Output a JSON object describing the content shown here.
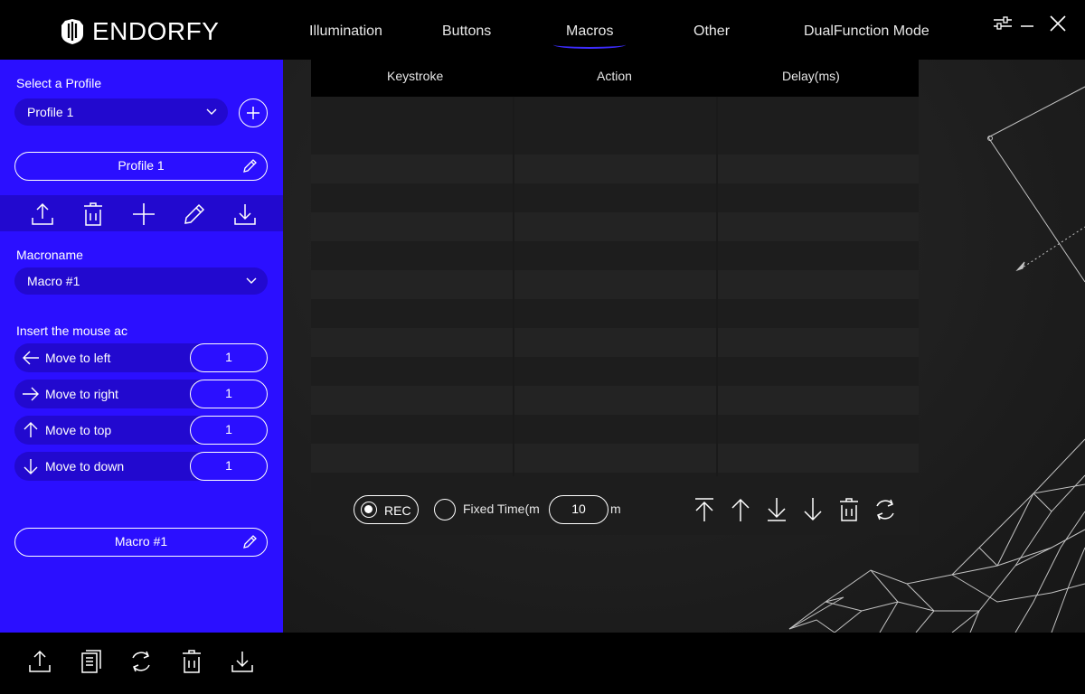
{
  "header": {
    "brand": "ENDORFY",
    "tabs": [
      {
        "label": "Illumination"
      },
      {
        "label": "Buttons"
      },
      {
        "label": "Macros"
      },
      {
        "label": "Other"
      },
      {
        "label": "DualFunction Mode"
      }
    ],
    "active_tab": "Macros"
  },
  "sidebar": {
    "select_profile_label": "Select a Profile",
    "profile_select_value": "Profile 1",
    "profile_name": "Profile 1",
    "macroname_label": "Macroname",
    "macro_select_value": "Macro #1",
    "mouse_actions_label": "Insert the mouse ac",
    "moves": [
      {
        "label": "Move to left",
        "value": "1"
      },
      {
        "label": "Move to right",
        "value": "1"
      },
      {
        "label": "Move to top",
        "value": "1"
      },
      {
        "label": "Move to down",
        "value": "1"
      }
    ],
    "macro_name": "Macro #1"
  },
  "macro_table": {
    "columns": [
      "Keystroke",
      "Action",
      "Delay(ms)"
    ]
  },
  "recording": {
    "rec_label": "REC",
    "fixed_time_label": "Fixed Time(m",
    "fixed_time_value": "10",
    "unit": "m"
  },
  "colors": {
    "sidebar_bg": "#2b0fff",
    "sidebar_dark": "#2209cf",
    "active_underline": "#3d2cff"
  }
}
